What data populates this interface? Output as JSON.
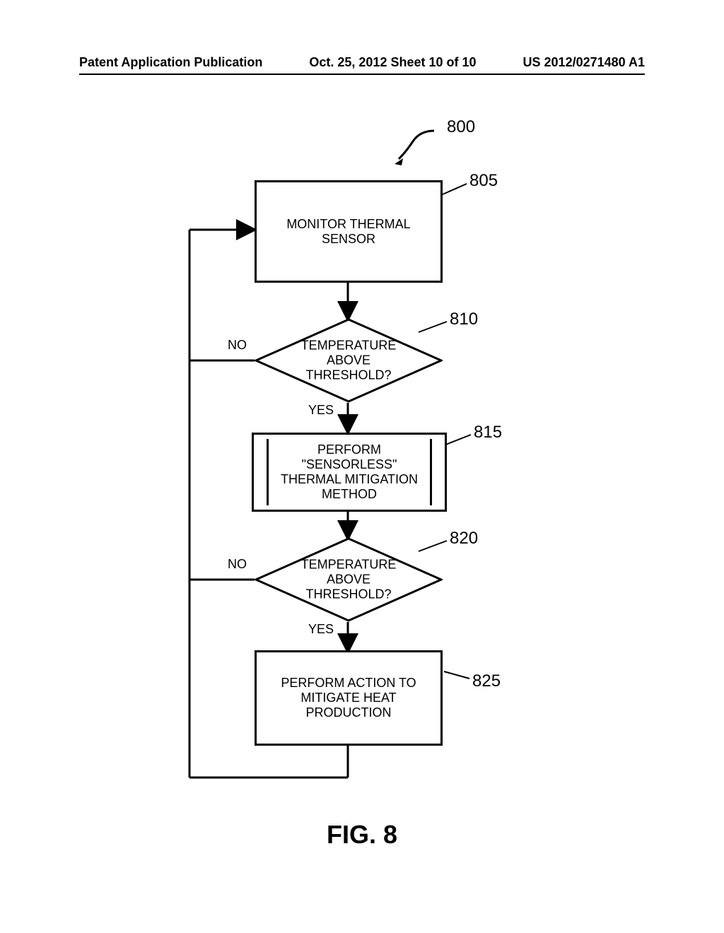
{
  "header": {
    "left": "Patent Application Publication",
    "center": "Oct. 25, 2012  Sheet 10 of 10",
    "right": "US 2012/0271480 A1"
  },
  "figure": {
    "overall_ref": "800",
    "caption": "FIG.  8",
    "blocks": {
      "b805": {
        "text": "MONITOR THERMAL SENSOR",
        "ref": "805"
      },
      "d810": {
        "text": "TEMPERATURE ABOVE THRESHOLD?",
        "ref": "810",
        "no": "NO",
        "yes": "YES"
      },
      "b815": {
        "text": "PERFORM \"SENSORLESS\" THERMAL MITIGATION METHOD",
        "ref": "815"
      },
      "d820": {
        "text": "TEMPERATURE ABOVE THRESHOLD?",
        "ref": "820",
        "no": "NO",
        "yes": "YES"
      },
      "b825": {
        "text": "PERFORM ACTION TO MITIGATE HEAT PRODUCTION",
        "ref": "825"
      }
    }
  },
  "chart_data": {
    "type": "flowchart",
    "title": "FIG. 8",
    "overall_reference": "800",
    "nodes": [
      {
        "id": "805",
        "shape": "process",
        "label": "MONITOR THERMAL SENSOR"
      },
      {
        "id": "810",
        "shape": "decision",
        "label": "TEMPERATURE ABOVE THRESHOLD?"
      },
      {
        "id": "815",
        "shape": "subroutine",
        "label": "PERFORM \"SENSORLESS\" THERMAL MITIGATION METHOD"
      },
      {
        "id": "820",
        "shape": "decision",
        "label": "TEMPERATURE ABOVE THRESHOLD?"
      },
      {
        "id": "825",
        "shape": "process",
        "label": "PERFORM ACTION TO MITIGATE HEAT PRODUCTION"
      }
    ],
    "edges": [
      {
        "from": "805",
        "to": "810",
        "label": ""
      },
      {
        "from": "810",
        "to": "815",
        "label": "YES"
      },
      {
        "from": "810",
        "to": "805",
        "label": "NO"
      },
      {
        "from": "815",
        "to": "820",
        "label": ""
      },
      {
        "from": "820",
        "to": "825",
        "label": "YES"
      },
      {
        "from": "820",
        "to": "805",
        "label": "NO"
      },
      {
        "from": "825",
        "to": "805",
        "label": ""
      }
    ]
  }
}
